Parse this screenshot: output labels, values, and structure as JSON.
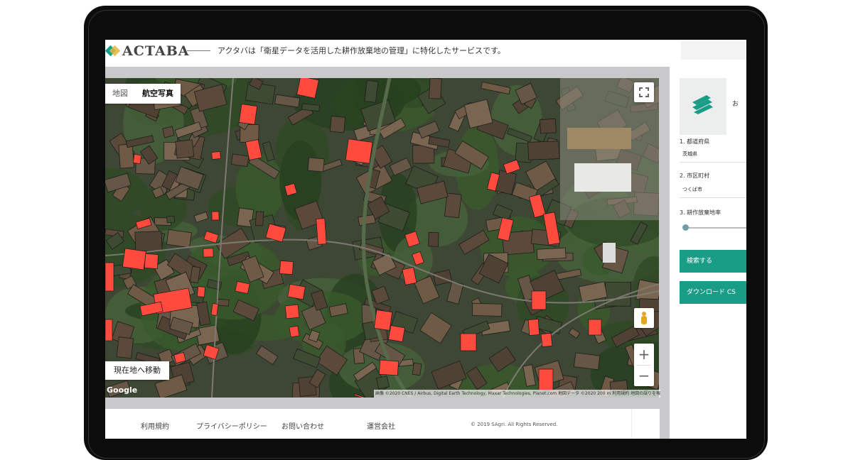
{
  "header": {
    "logo_text": "ACTABA",
    "tagline": "アクタバは「衛星データを活用した耕作放棄地の管理」に特化したサービスです。"
  },
  "map": {
    "type_tabs": [
      {
        "label": "地図",
        "active": false
      },
      {
        "label": "航空写真",
        "active": true
      }
    ],
    "locate_button": "現在地へ移動",
    "google_logo": "Google",
    "attribution": "画像 ©2020 CNES / Airbus, Digital Earth Technology, Maxar Technologies, Planet.com 地図データ ©2020  200 m  利用規約  地図の誤りを報告する",
    "zoom_in": "+",
    "zoom_out": "−",
    "highlight_color": "#ff4b3e"
  },
  "footer": {
    "links": [
      "利用規約",
      "プライバシーポリシー",
      "お問い合わせ",
      "運営会社"
    ],
    "copyright": "© 2019 SAgri. All Rights Reserved."
  },
  "panel": {
    "header_cut_text": "お",
    "step1_label": "1. 都道府県",
    "step1_value": "茨城県",
    "step2_label": "2. 市区町村",
    "step2_value": "つくば市",
    "step3_label": "3. 耕作放棄地率",
    "slider_value": 0,
    "search_button": "検索する",
    "download_button": "ダウンロード CS",
    "brand_color": "#1a9d87"
  }
}
